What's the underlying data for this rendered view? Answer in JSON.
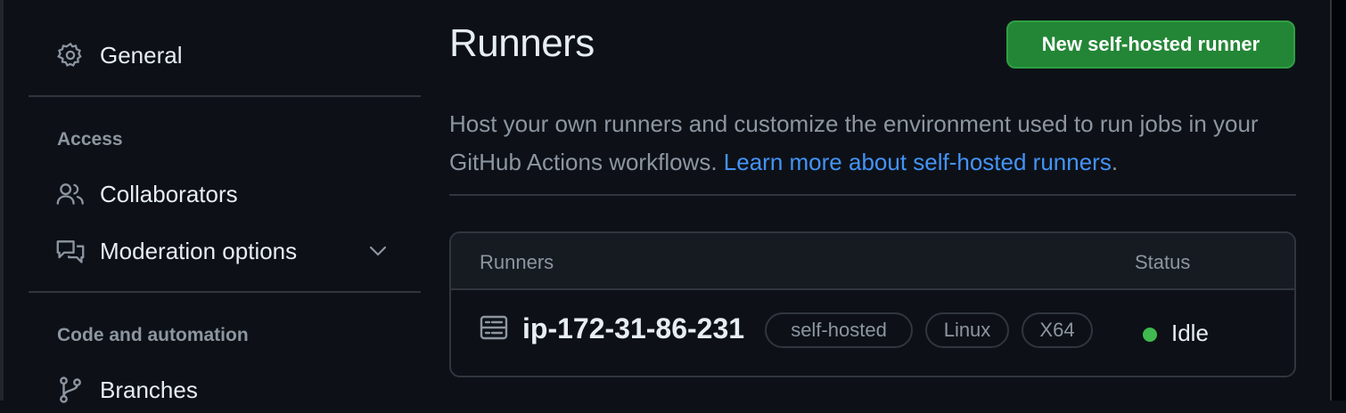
{
  "sidebar": {
    "general": "General",
    "access_heading": "Access",
    "collaborators": "Collaborators",
    "moderation": "Moderation options",
    "code_heading": "Code and automation",
    "branches": "Branches"
  },
  "main": {
    "title": "Runners",
    "new_button": "New self-hosted runner",
    "description": "Host your own runners and customize the environment used to run jobs in your GitHub Actions workflows.",
    "learn_more": "Learn more about self-hosted runners",
    "learn_more_suffix": "."
  },
  "table": {
    "col_runners": "Runners",
    "col_status": "Status",
    "rows": [
      {
        "name": "ip-172-31-86-231",
        "labels": [
          "self-hosted",
          "Linux",
          "X64"
        ],
        "status": "Idle",
        "status_color": "#3fb950"
      }
    ]
  },
  "colors": {
    "background": "#0d1117",
    "accent_link": "#4493f8",
    "button_green": "#238636"
  }
}
